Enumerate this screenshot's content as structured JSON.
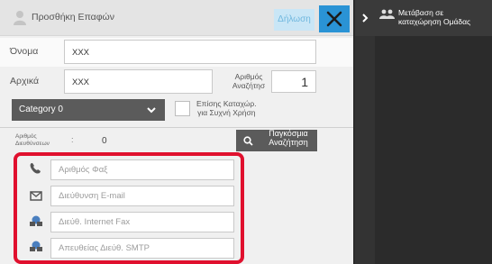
{
  "header": {
    "title": "Προσθήκη Επαφών",
    "declare_label": "Δήλωση",
    "close_label": "close"
  },
  "form": {
    "name_label": "Όνομα",
    "name_value": "XXX",
    "initials_label": "Αρχικά",
    "initials_value": "XXX",
    "search_number_label_line1": "Αριθμός",
    "search_number_label_line2": "Αναζήτησ",
    "search_number_value": "1",
    "category_value": "Category 0",
    "favorite_label_line1": "Επίσης Καταχώρ.",
    "favorite_label_line2": "για Συχνή Χρήση",
    "address_count_label_line1": "Αριθμός",
    "address_count_label_line2": "Διευθύνσεων",
    "address_count_value": "0",
    "global_search_line1": "Παγκόσμια",
    "global_search_line2": "Αναζήτηση"
  },
  "contacts": [
    {
      "icon": "fax-icon",
      "placeholder": "Αριθμός Φαξ"
    },
    {
      "icon": "email-icon",
      "placeholder": "Διεύθυνση E-mail"
    },
    {
      "icon": "internet-fax-icon",
      "placeholder": "Διεύθ. Internet Fax"
    },
    {
      "icon": "smtp-icon",
      "placeholder": "Απευθείας Διεύθ. SMTP"
    }
  ],
  "side": {
    "goto_group_line1": "Μετάβαση σε",
    "goto_group_line2": "καταχώρηση Ομάδας"
  },
  "colors": {
    "accent": "#2a93d5",
    "highlight": "#e0102e",
    "dark_control": "#5b5b5b"
  }
}
